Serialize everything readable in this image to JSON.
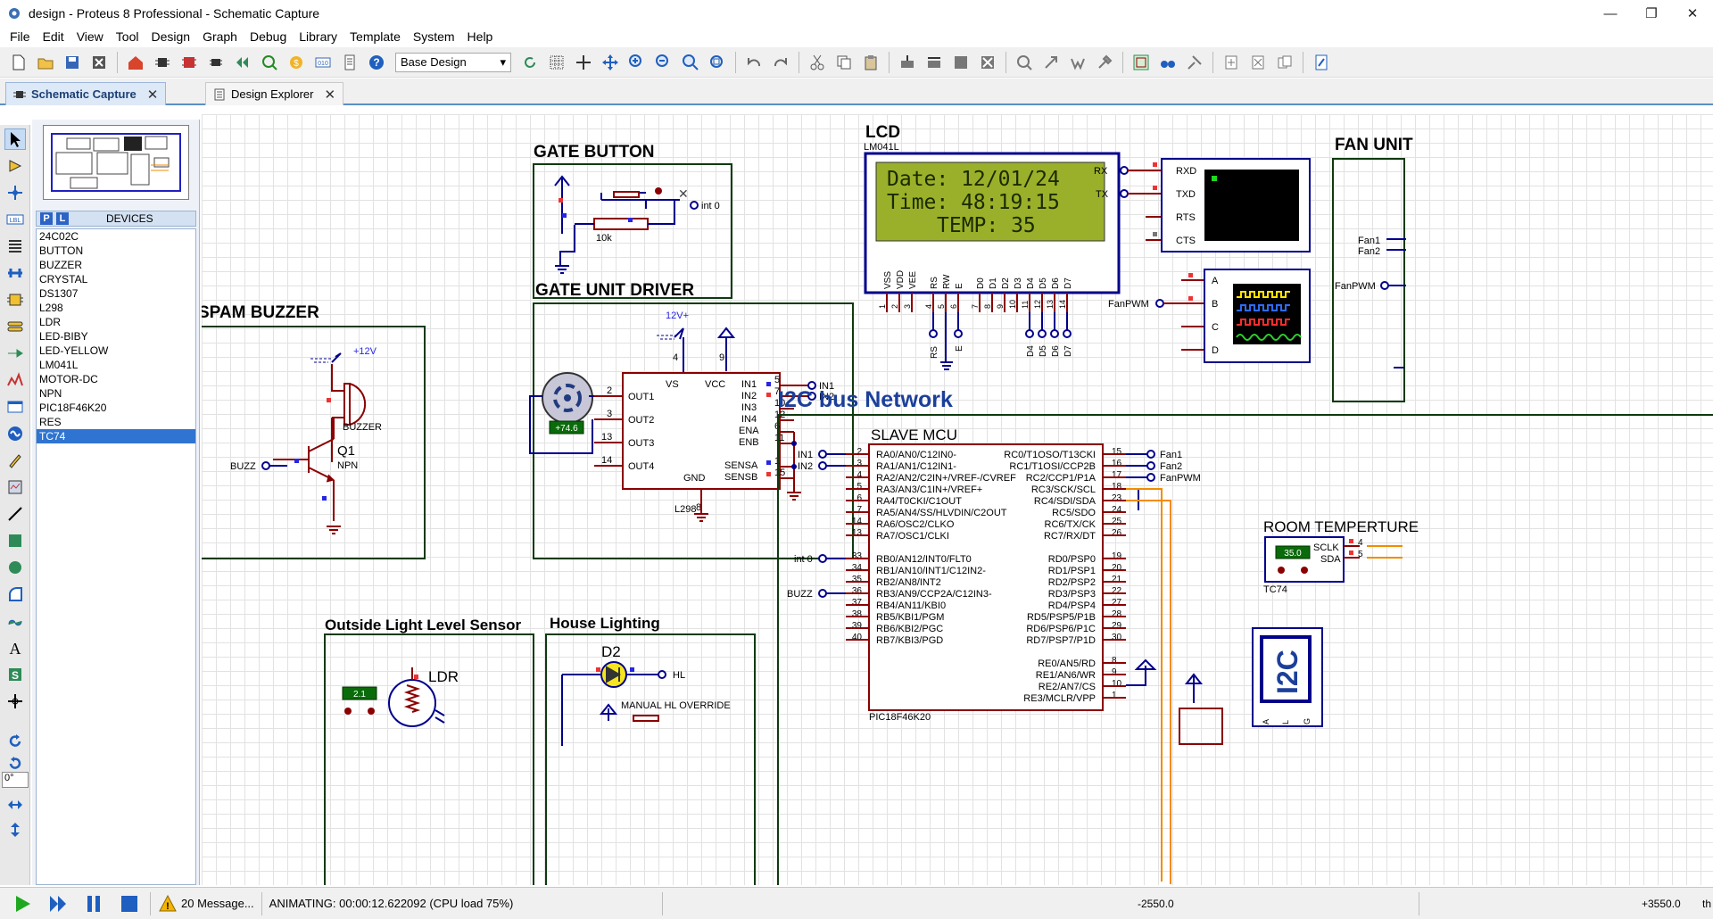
{
  "window": {
    "title": "design - Proteus 8 Professional - Schematic Capture",
    "controls": [
      "—",
      "❐",
      "✕"
    ]
  },
  "menu": [
    "File",
    "Edit",
    "View",
    "Tool",
    "Design",
    "Graph",
    "Debug",
    "Library",
    "Template",
    "System",
    "Help"
  ],
  "toolbar": {
    "design_select": "Base Design"
  },
  "tabs": [
    {
      "label": "Schematic Capture",
      "active": true
    },
    {
      "label": "Design Explorer",
      "active": false
    }
  ],
  "devices": {
    "mode_p": "P",
    "mode_l": "L",
    "header": "DEVICES",
    "items": [
      "24C02C",
      "BUTTON",
      "BUZZER",
      "CRYSTAL",
      "DS1307",
      "L298",
      "LDR",
      "LED-BIBY",
      "LED-YELLOW",
      "LM041L",
      "MOTOR-DC",
      "NPN",
      "PIC18F46K20",
      "RES",
      "TC74"
    ],
    "selected": "TC74"
  },
  "rotation_field": "0°",
  "schematic": {
    "gate_button": {
      "title": "GATE BUTTON",
      "res_label": "10k",
      "terminal": "int 0"
    },
    "gate_unit_driver": {
      "title": "GATE UNIT DRIVER",
      "power": "12V+",
      "motor_readout": "+74.6",
      "chip": "L298",
      "pins_left": [
        "OUT1",
        "OUT2",
        "OUT3",
        "OUT4"
      ],
      "pins_left_num": [
        "2",
        "3",
        "13",
        "14"
      ],
      "pins_right": [
        "IN1",
        "IN2",
        "IN3",
        "IN4",
        "ENA",
        "ENB",
        "SENSA",
        "SENSB"
      ],
      "pins_right_num": [
        "5",
        "7",
        "10",
        "12",
        "6",
        "11",
        "1",
        "15"
      ],
      "top_labels": [
        "VS",
        "VCC"
      ],
      "top_pins": [
        "4",
        "9"
      ],
      "gnd_label": "GND",
      "gnd_pin": "8",
      "terminals": [
        "IN1",
        "IN2"
      ]
    },
    "spam_buzzer": {
      "title": "SPAM BUZZER",
      "supply": "+12V",
      "buzzer_label": "BUZZER",
      "q_label": "Q1",
      "q_type": "NPN",
      "terminal": "BUZZ"
    },
    "lcd": {
      "title": "LCD",
      "part": "LM041L",
      "lines": [
        "Date: 12/01/24",
        "Time: 48:19:15",
        "TEMP: 35"
      ],
      "pins": [
        "VSS",
        "VDD",
        "VEE",
        "RS",
        "RW",
        "E",
        "D0",
        "D1",
        "D2",
        "D3",
        "D4",
        "D5",
        "D6",
        "D7"
      ],
      "pin_nums": [
        "1",
        "2",
        "3",
        "4",
        "5",
        "6",
        "7",
        "8",
        "9",
        "10",
        "11",
        "12",
        "13",
        "14"
      ],
      "terminals": [
        "RS",
        "E",
        "D4",
        "D5",
        "D6",
        "D7"
      ]
    },
    "terminal": {
      "labels": [
        "RXD",
        "TXD",
        "RTS",
        "CTS"
      ],
      "inputs": [
        "RX",
        "TX"
      ]
    },
    "scope": {
      "labels": [
        "A",
        "B",
        "C",
        "D"
      ],
      "input": "FanPWM"
    },
    "fan_unit": {
      "title": "FAN UNIT",
      "inputs": [
        "Fan1",
        "Fan2",
        "FanPWM"
      ]
    },
    "i2c": {
      "title": "I2C bus Network",
      "mcu_title": "SLAVE MCU",
      "mcu_part": "PIC18F46K20",
      "left_pins": [
        "RA0/AN0/C12IN0-",
        "RA1/AN1/C12IN1-",
        "RA2/AN2/C2IN+/VREF-/CVREF",
        "RA3/AN3/C1IN+/VREF+",
        "RA4/T0CKI/C1OUT",
        "RA5/AN4/SS/HLVDIN/C2OUT",
        "RA6/OSC2/CLKO",
        "RA7/OSC1/CLKI",
        "RB0/AN12/INT0/FLT0",
        "RB1/AN10/INT1/C12IN2-",
        "RB2/AN8/INT2",
        "RB3/AN9/CCP2A/C12IN3-",
        "RB4/AN11/KBI0",
        "RB5/KBI1/PGM",
        "RB6/KBI2/PGC",
        "RB7/KBI3/PGD"
      ],
      "left_nums": [
        "2",
        "3",
        "4",
        "5",
        "6",
        "7",
        "14",
        "13",
        "33",
        "34",
        "35",
        "36",
        "37",
        "38",
        "39",
        "40"
      ],
      "right_pins": [
        "RC0/T1OSO/T13CKI",
        "RC1/T1OSI/CCP2B",
        "RC2/CCP1/P1A",
        "RC3/SCK/SCL",
        "RC4/SDI/SDA",
        "RC5/SDO",
        "RC6/TX/CK",
        "RC7/RX/DT",
        "RD0/PSP0",
        "RD1/PSP1",
        "RD2/PSP2",
        "RD3/PSP3",
        "RD4/PSP4",
        "RD5/PSP5/P1B",
        "RD6/PSP6/P1C",
        "RD7/PSP7/P1D",
        "RE0/AN5/RD",
        "RE1/AN6/WR",
        "RE2/AN7/CS",
        "RE3/MCLR/VPP"
      ],
      "right_nums": [
        "15",
        "16",
        "17",
        "18",
        "23",
        "24",
        "25",
        "26",
        "19",
        "20",
        "21",
        "22",
        "27",
        "28",
        "29",
        "30",
        "8",
        "9",
        "10",
        "1"
      ],
      "left_terms": [
        "IN1",
        "IN2",
        "int 0",
        "BUZZ"
      ],
      "right_terms": [
        "Fan1",
        "Fan2",
        "FanPWM"
      ]
    },
    "room_temp": {
      "title": "ROOM TEMPERTURE",
      "readout": "35.0",
      "pins": [
        "SCLK",
        "SDA"
      ],
      "pin_nums": [
        "4",
        "5"
      ],
      "part": "TC74"
    },
    "i2c_debugger": {
      "label": "I2C",
      "pins": [
        "A",
        "L",
        "G"
      ]
    },
    "light_sensor": {
      "title": "Outside Light Level Sensor",
      "readout": "2.1",
      "label": "LDR"
    },
    "house_lighting": {
      "title": "House Lighting",
      "diode": "D2",
      "terminal": "HL",
      "override": "MANUAL HL OVERRIDE"
    }
  },
  "status": {
    "messages": "20 Message...",
    "animating": "ANIMATING: 00:00:12.622092 (CPU load 75%)",
    "coord_x": "-2550.0",
    "coord_y": "+3550.0",
    "unit": "th"
  },
  "colors": {
    "wire": "#00008b",
    "component": "#8b0000",
    "lcd_bg": "#9ab02a",
    "lcd_text": "#1b2a00",
    "i2c_bus": "#f28c00",
    "accent": "#2f74d0"
  }
}
